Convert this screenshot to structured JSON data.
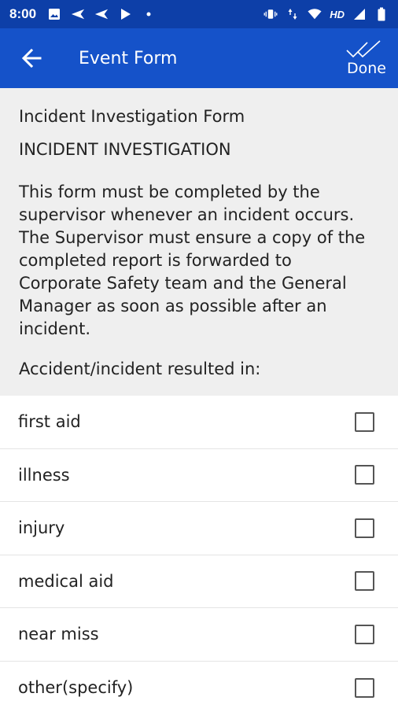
{
  "status_bar": {
    "time": "8:00",
    "left_icons": [
      "image-icon",
      "send-icon",
      "send-icon",
      "play-icon",
      "dot-icon"
    ],
    "right_icons": [
      "vibrate-icon",
      "data-arrows-icon",
      "wifi-icon",
      "hd-badge",
      "signal-icon",
      "battery-icon"
    ],
    "hd_label": "HD"
  },
  "app_bar": {
    "title": "Event Form",
    "done_label": "Done",
    "color": "#1552c9"
  },
  "form": {
    "name": "Incident Investigation Form",
    "heading": "INCIDENT INVESTIGATION",
    "description": "This form must be completed by the supervisor whenever an incident occurs. The Supervisor must ensure a copy of the completed report is forwarded to Corporate Safety team and the General Manager as soon as possible after an incident.",
    "question": "Accident/incident resulted in:",
    "options": [
      {
        "label": "first aid",
        "checked": false
      },
      {
        "label": "illness",
        "checked": false
      },
      {
        "label": "injury",
        "checked": false
      },
      {
        "label": "medical aid",
        "checked": false
      },
      {
        "label": "near miss",
        "checked": false
      },
      {
        "label": "other(specify)",
        "checked": false
      }
    ]
  }
}
